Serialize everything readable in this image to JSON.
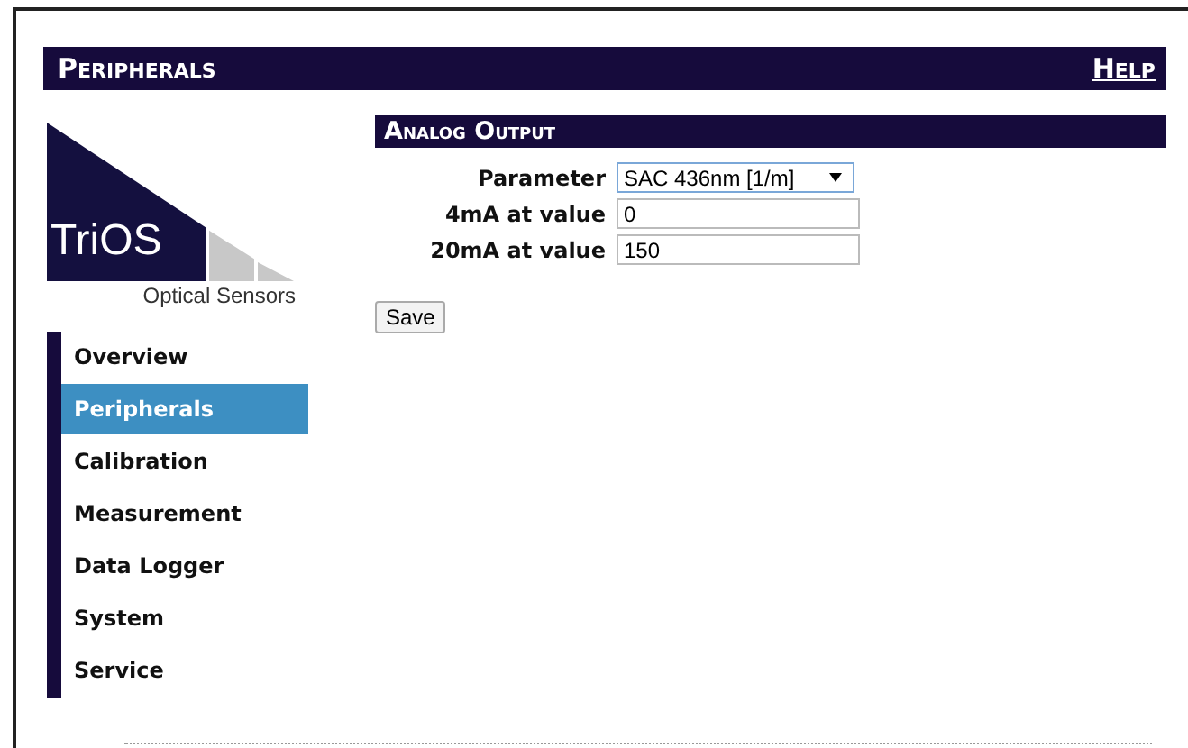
{
  "header": {
    "title": "Peripherals",
    "help_link": "Help"
  },
  "logo": {
    "brand": "TriOS",
    "tagline": "Optical Sensors"
  },
  "nav": [
    {
      "label": "Overview",
      "selected": false
    },
    {
      "label": "Peripherals",
      "selected": true
    },
    {
      "label": "Calibration",
      "selected": false
    },
    {
      "label": "Measurement",
      "selected": false
    },
    {
      "label": "Data Logger",
      "selected": false
    },
    {
      "label": "System",
      "selected": false
    },
    {
      "label": "Service",
      "selected": false
    }
  ],
  "section": {
    "title": "Analog Output"
  },
  "form": [
    {
      "kind": "select",
      "label": "Parameter",
      "value": "SAC 436nm [1/m]"
    },
    {
      "kind": "text",
      "label": "4mA at value",
      "value": "0"
    },
    {
      "kind": "text",
      "label": "20mA at value",
      "value": "150"
    }
  ],
  "save_button": "Save"
}
